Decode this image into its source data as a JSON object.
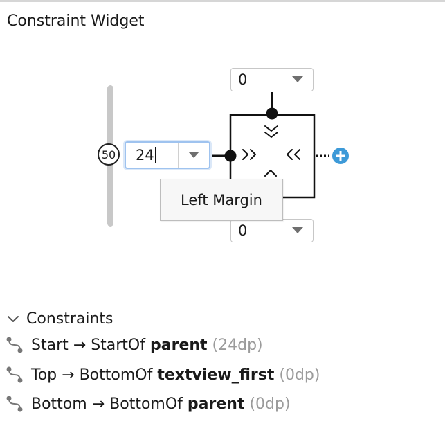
{
  "panel": {
    "title": "Constraint Widget"
  },
  "widget": {
    "bias_value": "50",
    "top_margin": "0",
    "left_margin": "24",
    "bottom_margin": "0",
    "tooltip": "Left Margin",
    "accent_color": "#3d9ad8"
  },
  "constraints": {
    "header": "Constraints",
    "items": [
      {
        "source": "Start",
        "arrow": "→",
        "relation": "StartOf",
        "target": "parent",
        "margin": "(24dp)"
      },
      {
        "source": "Top",
        "arrow": "→",
        "relation": "BottomOf",
        "target": "textview_first",
        "margin": "(0dp)"
      },
      {
        "source": "Bottom",
        "arrow": "→",
        "relation": "BottomOf",
        "target": "parent",
        "margin": "(0dp)"
      }
    ]
  },
  "icons": {
    "collapse": "chevron-down-icon",
    "constraint": "constraint-link-icon",
    "add": "plus-circle-icon",
    "dropdown": "triangle-down-icon"
  }
}
